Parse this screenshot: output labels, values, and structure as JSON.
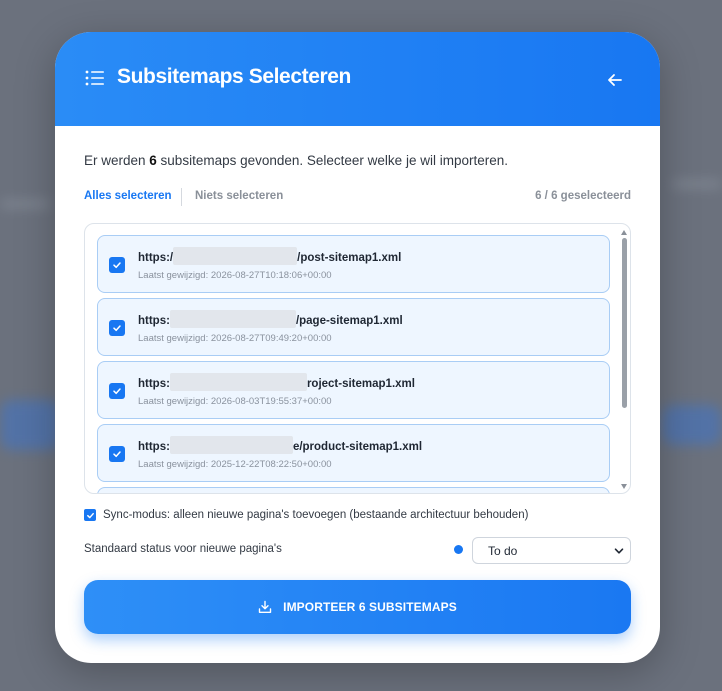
{
  "header": {
    "title": "Subsitemaps Selecteren"
  },
  "intro": {
    "prefix": "Er werden ",
    "count": "6",
    "suffix": " subsitemaps gevonden. Selecteer welke je wil importeren."
  },
  "selection": {
    "select_all": "Alles selecteren",
    "select_none": "Niets selecteren",
    "count_label": "6 / 6 geselecteerd"
  },
  "sitemaps": [
    {
      "url_prefix": "https:/",
      "url_suffix": "/post-sitemap1.xml",
      "modified": "Laatst gewijzigd: 2026-08-27T10:18:06+00:00",
      "checked": true
    },
    {
      "url_prefix": "https:",
      "url_suffix": "/page-sitemap1.xml",
      "modified": "Laatst gewijzigd: 2026-08-27T09:49:20+00:00",
      "checked": true
    },
    {
      "url_prefix": "https:",
      "url_suffix": "roject-sitemap1.xml",
      "modified": "Laatst gewijzigd: 2026-08-03T19:55:37+00:00",
      "checked": true
    },
    {
      "url_prefix": "https:",
      "url_suffix": "e/product-sitemap1.xml",
      "modified": "Laatst gewijzigd: 2025-12-22T08:22:50+00:00",
      "checked": true
    }
  ],
  "sync": {
    "label": "Sync-modus: alleen nieuwe pagina's toevoegen (bestaande architectuur behouden)",
    "checked": true
  },
  "status": {
    "label": "Standaard status voor nieuwe pagina's",
    "selected": "To do",
    "dot_color": "#1877f2"
  },
  "import_button": {
    "label": "IMPORTEER 6 SUBSITEMAPS"
  },
  "colors": {
    "accent": "#1877f2",
    "item_bg": "#eef6ff",
    "item_border": "#a9cdf5"
  },
  "icons": {
    "header_left": "list-icon",
    "header_right": "arrow-left-icon",
    "button": "download-icon"
  }
}
